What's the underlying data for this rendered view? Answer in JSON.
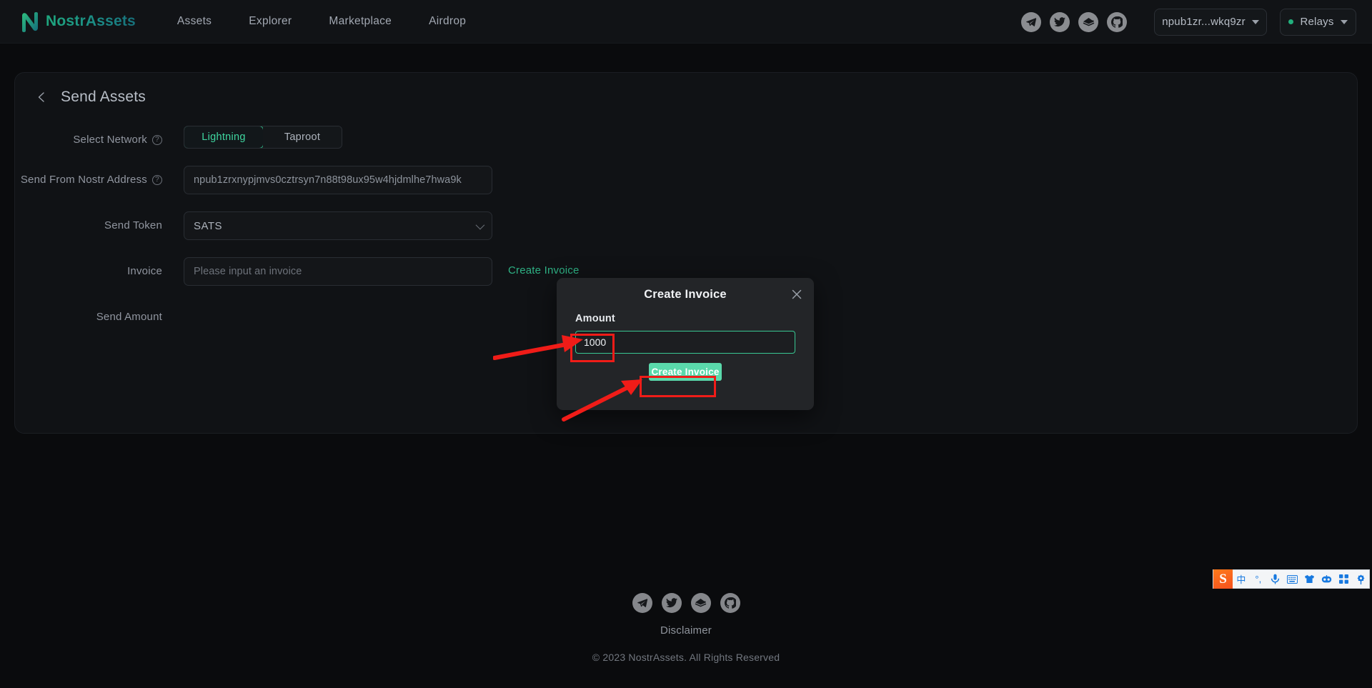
{
  "header": {
    "brand": "NostrAssets",
    "nav": [
      {
        "label": "Assets"
      },
      {
        "label": "Explorer"
      },
      {
        "label": "Marketplace"
      },
      {
        "label": "Airdrop"
      }
    ],
    "socials": [
      {
        "name": "telegram-icon"
      },
      {
        "name": "twitter-icon"
      },
      {
        "name": "nostr-icon"
      },
      {
        "name": "github-icon"
      }
    ],
    "account_label": "npub1zr...wkq9zr",
    "relays_label": "Relays",
    "accent": "#2eb184",
    "online_dot": "#22b07d"
  },
  "page": {
    "title": "Send Assets",
    "back_icon": "chevron-left-icon"
  },
  "form": {
    "network": {
      "label": "Select Network",
      "help_icon": "question-mark-icon",
      "options": [
        "Lightning",
        "Taproot"
      ],
      "selected": "Lightning"
    },
    "nostr_address": {
      "label": "Send From Nostr Address",
      "help_icon": "question-mark-icon",
      "value": "npub1zrxnypjmvs0cztrsyn7n88t98ux95w4hjdmlhe7hwa9k",
      "placeholder": ""
    },
    "token": {
      "label": "Send Token",
      "value": "SATS",
      "options": [
        "SATS"
      ]
    },
    "invoice": {
      "label": "Invoice",
      "value": "",
      "placeholder": "Please input an invoice",
      "create_link": "Create Invoice"
    },
    "send_amount": {
      "label": "Send Amount",
      "value": ""
    }
  },
  "modal": {
    "title": "Create Invoice",
    "close_icon": "close-icon",
    "amount_label": "Amount",
    "amount_value": "1000",
    "amount_placeholder": "",
    "submit_label": "Create Invoice",
    "accent_border": "#38c893",
    "submit_bg": "#5ad9ab"
  },
  "annotations": {
    "highlight_color": "#f01c18",
    "items": [
      {
        "name": "amount-input-highlight"
      },
      {
        "name": "create-invoice-button-highlight"
      }
    ]
  },
  "footer": {
    "socials": [
      {
        "name": "telegram-icon"
      },
      {
        "name": "twitter-icon"
      },
      {
        "name": "nostr-icon"
      },
      {
        "name": "github-icon"
      }
    ],
    "disclaimer": "Disclaimer",
    "copyright": "© 2023 NostrAssets. All Rights Reserved"
  },
  "ime": {
    "logo": "S",
    "items": [
      {
        "name": "chinese-mode-icon",
        "glyph": "中"
      },
      {
        "name": "punctuation-icon",
        "glyph": "°,"
      },
      {
        "name": "voice-input-icon",
        "glyph": ""
      },
      {
        "name": "soft-keyboard-icon",
        "glyph": ""
      },
      {
        "name": "skin-icon",
        "glyph": ""
      },
      {
        "name": "robot-icon",
        "glyph": ""
      },
      {
        "name": "toolbox-icon",
        "glyph": ""
      },
      {
        "name": "settings-icon",
        "glyph": ""
      }
    ]
  }
}
